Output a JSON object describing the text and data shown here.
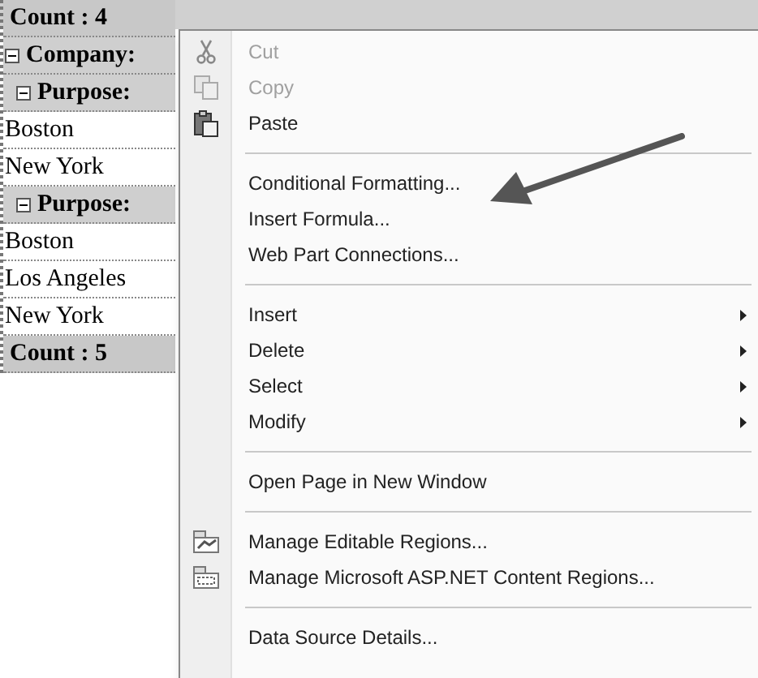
{
  "grid": {
    "rows": [
      {
        "kind": "count",
        "text": "Count : 4"
      },
      {
        "kind": "group",
        "text": "Company:",
        "expanded": true,
        "indent": false
      },
      {
        "kind": "group",
        "text": "Purpose:",
        "expanded": true,
        "indent": true
      },
      {
        "kind": "cell",
        "text": "Boston"
      },
      {
        "kind": "cell",
        "text": "New York"
      },
      {
        "kind": "group",
        "text": "Purpose:",
        "expanded": true,
        "indent": true
      },
      {
        "kind": "cell",
        "text": "Boston"
      },
      {
        "kind": "cell",
        "text": "Los Angeles"
      },
      {
        "kind": "cell",
        "text": "New York"
      },
      {
        "kind": "count",
        "text": "Count : 5"
      }
    ]
  },
  "context_menu": {
    "items": [
      {
        "kind": "item",
        "label": "Cut",
        "disabled": true,
        "submenu": false
      },
      {
        "kind": "item",
        "label": "Copy",
        "disabled": true,
        "submenu": false
      },
      {
        "kind": "item",
        "label": "Paste",
        "disabled": false,
        "submenu": false
      },
      {
        "kind": "separator"
      },
      {
        "kind": "item",
        "label": "Conditional Formatting...",
        "disabled": false,
        "submenu": false
      },
      {
        "kind": "item",
        "label": "Insert Formula...",
        "disabled": false,
        "submenu": false
      },
      {
        "kind": "item",
        "label": "Web Part Connections...",
        "disabled": false,
        "submenu": false
      },
      {
        "kind": "separator"
      },
      {
        "kind": "item",
        "label": "Insert",
        "disabled": false,
        "submenu": true
      },
      {
        "kind": "item",
        "label": "Delete",
        "disabled": false,
        "submenu": true
      },
      {
        "kind": "item",
        "label": "Select",
        "disabled": false,
        "submenu": true
      },
      {
        "kind": "item",
        "label": "Modify",
        "disabled": false,
        "submenu": true
      },
      {
        "kind": "separator"
      },
      {
        "kind": "item",
        "label": "Open Page in New Window",
        "disabled": false,
        "submenu": false
      },
      {
        "kind": "separator"
      },
      {
        "kind": "item",
        "label": "Manage Editable Regions...",
        "disabled": false,
        "submenu": false
      },
      {
        "kind": "item",
        "label": "Manage Microsoft ASP.NET Content Regions...",
        "disabled": false,
        "submenu": false
      },
      {
        "kind": "separator"
      },
      {
        "kind": "item",
        "label": "Data Source Details...",
        "disabled": false,
        "submenu": false
      }
    ]
  }
}
